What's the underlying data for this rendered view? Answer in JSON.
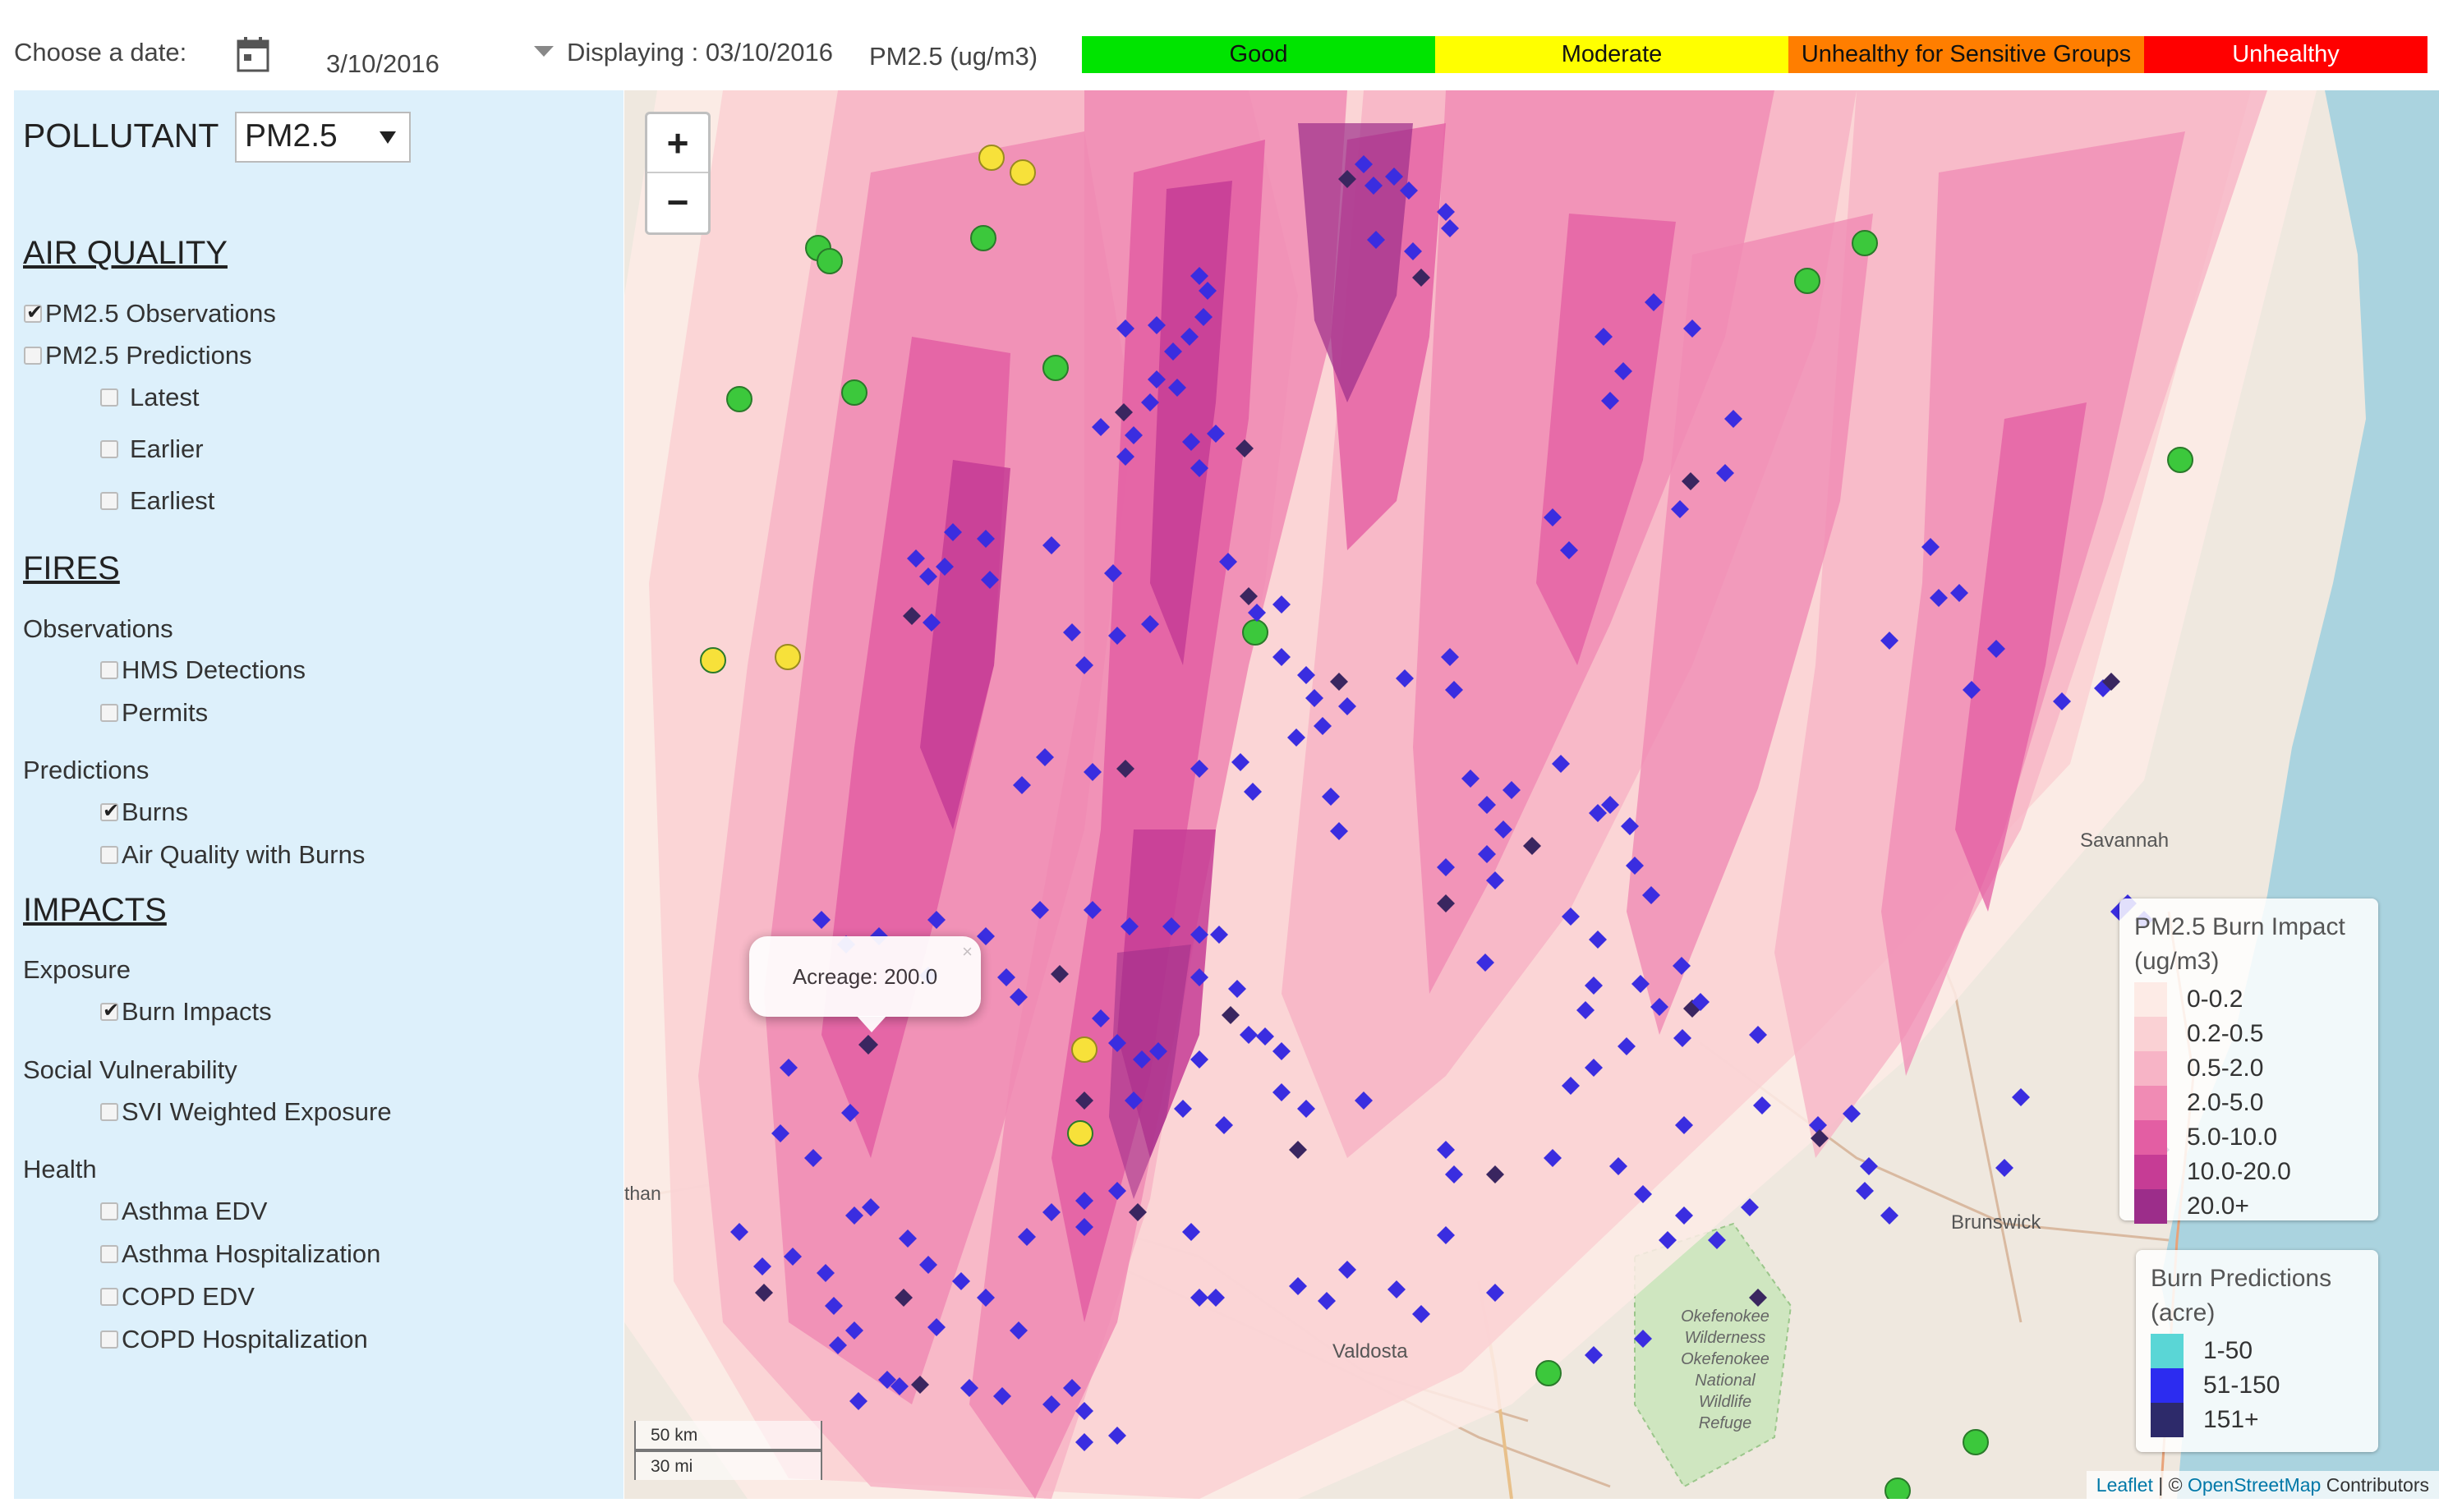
{
  "topbar": {
    "date_label": "Choose a date:",
    "date_value": "3/10/2016",
    "displaying": "Displaying : 03/10/2016",
    "metric_label": "PM2.5 (ug/m3)",
    "aqi": [
      {
        "label": "Good",
        "color": "#00e400"
      },
      {
        "label": "Moderate",
        "color": "#ffff00"
      },
      {
        "label": "Unhealthy for Sensitive Groups",
        "color": "#ff7e00"
      },
      {
        "label": "Unhealthy",
        "color": "#ff0000"
      }
    ]
  },
  "sidebar": {
    "pollutant_label": "POLLUTANT",
    "pollutant_value": "PM2.5",
    "air_quality": {
      "heading": "AIR QUALITY",
      "obs": {
        "label": "PM2.5 Observations",
        "checked": true
      },
      "pred": {
        "label": "PM2.5 Predictions",
        "checked": false
      },
      "latest": {
        "label": "Latest",
        "checked": false
      },
      "earlier": {
        "label": "Earlier",
        "checked": false
      },
      "earliest": {
        "label": "Earliest",
        "checked": false
      }
    },
    "fires": {
      "heading": "FIRES",
      "observations": "Observations",
      "hms": {
        "label": "HMS Detections",
        "checked": false
      },
      "permits": {
        "label": "Permits",
        "checked": false
      },
      "predictions": "Predictions",
      "burns": {
        "label": "Burns",
        "checked": true
      },
      "aq_burns": {
        "label": "Air Quality with Burns",
        "checked": false
      }
    },
    "impacts": {
      "heading": "IMPACTS",
      "exposure": "Exposure",
      "burn_impacts": {
        "label": "Burn Impacts",
        "checked": true
      },
      "social": "Social Vulnerability",
      "svi": {
        "label": "SVI Weighted Exposure",
        "checked": false
      },
      "health": "Health",
      "asthma_edv": {
        "label": "Asthma EDV",
        "checked": false
      },
      "asthma_hosp": {
        "label": "Asthma Hospitalization",
        "checked": false
      },
      "copd_edv": {
        "label": "COPD EDV",
        "checked": false
      },
      "copd_hosp": {
        "label": "COPD Hospitalization",
        "checked": false
      }
    }
  },
  "map": {
    "zoom_in": "+",
    "zoom_out": "−",
    "place_labels": {
      "savannah": "Savannah",
      "brunswick": "Brunswick",
      "valdosta": "Valdosta",
      "okefenokee": [
        "Okefenokee",
        "Wilderness",
        "Okefenokee",
        "National",
        "Wildlife",
        "Refuge"
      ],
      "than": "than"
    },
    "popup": {
      "text": "Acreage: 200.0",
      "close": "×"
    },
    "pm_legend": {
      "title_line1": "PM2.5 Burn Impact",
      "title_line2": "(ug/m3)",
      "rows": [
        {
          "label": "0-0.2",
          "color": "#fdebe6"
        },
        {
          "label": "0.2-0.5",
          "color": "#fad1d4"
        },
        {
          "label": "0.5-2.0",
          "color": "#f7b4c6"
        },
        {
          "label": "2.0-5.0",
          "color": "#f08bb4"
        },
        {
          "label": "5.0-10.0",
          "color": "#e35ea3"
        },
        {
          "label": "10.0-20.0",
          "color": "#c63c95"
        },
        {
          "label": "20.0+",
          "color": "#9c2d8a"
        }
      ]
    },
    "burn_legend": {
      "title_line1": "Burn Predictions",
      "title_line2": "(acre)",
      "rows": [
        {
          "label": "1-50",
          "color": "#5ad6d6"
        },
        {
          "label": "51-150",
          "color": "#2c2cf0"
        },
        {
          "label": "151+",
          "color": "#2d2a6a"
        }
      ]
    },
    "scale": {
      "km": "50 km",
      "mi": "30 mi"
    },
    "attribution": {
      "leaflet": "Leaflet",
      "sep": " | © ",
      "osm": "OpenStreetMap",
      "rest": " Contributors"
    },
    "colors": {
      "obs_good": "#3cc83c",
      "obs_moderate": "#f7e13a",
      "burn_marker": "#3a2de0",
      "burn_marker_large": "#3a2660"
    }
  }
}
